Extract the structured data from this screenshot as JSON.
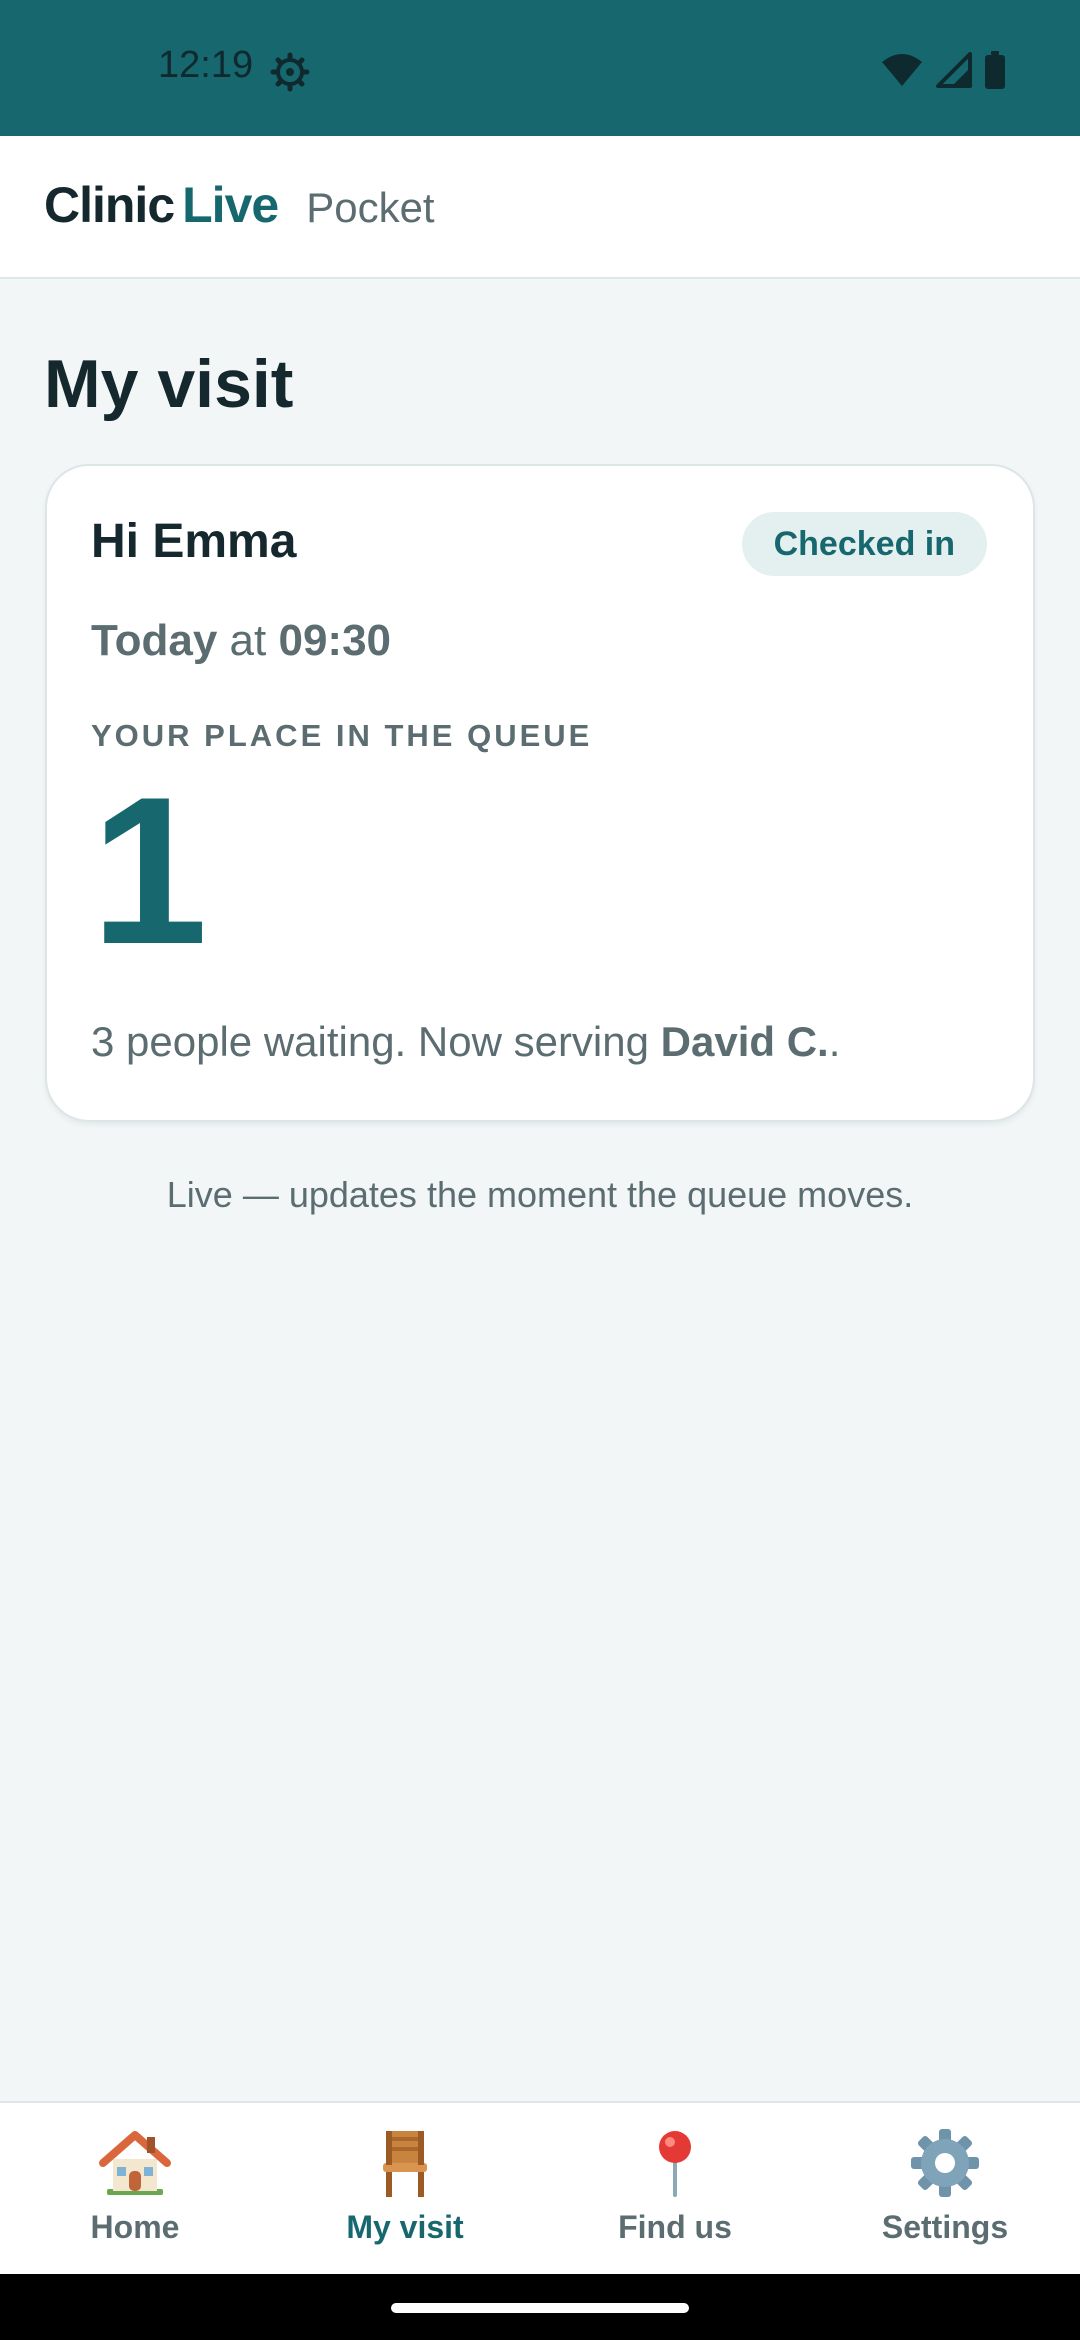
{
  "status_bar": {
    "time": "12:19",
    "icons": [
      "settings-gear-icon",
      "wifi-icon",
      "cell-signal-icon",
      "battery-icon"
    ]
  },
  "header": {
    "brand_part1": "Clinic",
    "brand_part2": "Live",
    "brand_subtitle": "Pocket"
  },
  "page": {
    "title": "My visit"
  },
  "visit_card": {
    "greeting": "Hi Emma",
    "status_badge": "Checked in",
    "day": "Today",
    "time_connector": "at",
    "time": "09:30",
    "queue_label": "YOUR PLACE IN THE QUEUE",
    "queue_position": "1",
    "waiting_text": "3 people waiting. Now serving",
    "serving_name": "David C.",
    "serving_suffix": "."
  },
  "live_note": "Live — updates the moment the queue moves.",
  "bottom_nav": {
    "items": [
      {
        "label": "Home",
        "icon": "house-icon",
        "active": false
      },
      {
        "label": "My visit",
        "icon": "chair-icon",
        "active": true
      },
      {
        "label": "Find us",
        "icon": "map-pin-icon",
        "active": false
      },
      {
        "label": "Settings",
        "icon": "gear-icon",
        "active": false
      }
    ]
  },
  "colors": {
    "brand_teal": "#17686e",
    "background": "#f2f6f7",
    "text_dark": "#15282d",
    "text_muted": "#5b6d71",
    "badge_bg": "#e4efef"
  }
}
